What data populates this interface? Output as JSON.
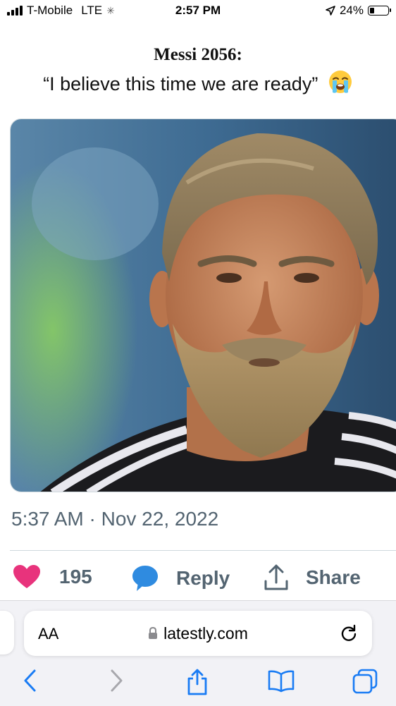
{
  "status_bar": {
    "carrier": "T-Mobile",
    "network": "LTE",
    "time": "2:57 PM",
    "battery": "24%",
    "battery_level": 0.24
  },
  "tweet": {
    "line1": "Messi 2056:",
    "line2": "“I believe this time we are ready”",
    "emoji": "loudly-crying-face",
    "timestamp": "5:37 AM · Nov 22, 2022"
  },
  "actions": {
    "like_count": "195",
    "reply_label": "Reply",
    "share_label": "Share"
  },
  "browser": {
    "text_size_label": "AA",
    "url": "latestly.com"
  },
  "colors": {
    "like": "#e8337c",
    "reply": "#2f8be0",
    "safari_blue": "#1a7cf4",
    "muted": "#536471"
  }
}
